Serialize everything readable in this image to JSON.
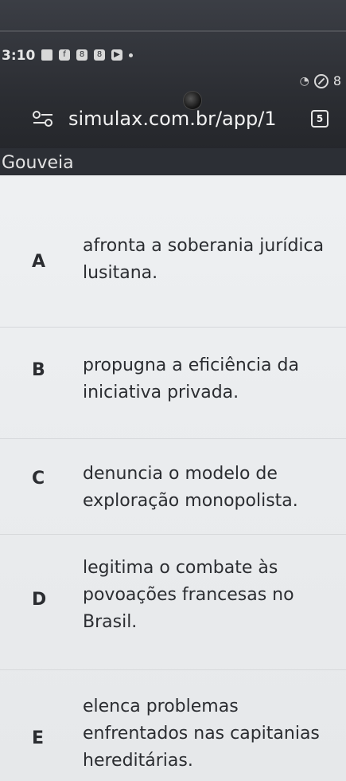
{
  "status_bar": {
    "time": "3:10",
    "battery": "8"
  },
  "browser": {
    "url": "simulax.com.br/app/1",
    "tab_count": "5"
  },
  "header": {
    "name": "Gouveia"
  },
  "options": [
    {
      "letter": "A",
      "text": "afronta a soberania jurídica lusitana."
    },
    {
      "letter": "B",
      "text": "propugna a eficiência da iniciativa privada."
    },
    {
      "letter": "C",
      "text": "denuncia o modelo de exploração monopolista."
    },
    {
      "letter": "D",
      "text": "legitima o combate às povoações francesas no Brasil."
    },
    {
      "letter": "E",
      "text": "elenca problemas enfrentados nas capitanias hereditárias."
    }
  ]
}
